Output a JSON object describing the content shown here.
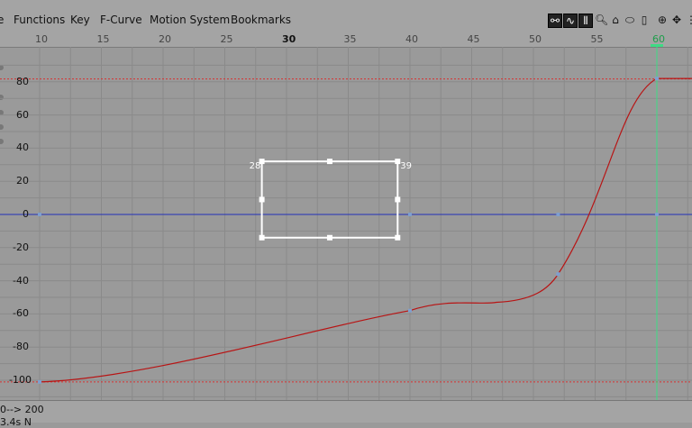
{
  "menubar": {
    "items": [
      {
        "label": "e",
        "name": "menu-edit"
      },
      {
        "label": "Functions",
        "name": "menu-functions"
      },
      {
        "label": "Key",
        "name": "menu-key"
      },
      {
        "label": "F-Curve",
        "name": "menu-f-curve"
      },
      {
        "label": "Motion System",
        "name": "menu-motion-system"
      },
      {
        "label": "Bookmarks",
        "name": "menu-bookmarks"
      }
    ]
  },
  "toolbar": {
    "icons": [
      "curve-link-icon",
      "fcurve-mode-icon",
      "dopesheet-mode-icon",
      "zoom-icon",
      "home-icon",
      "frame-all-icon",
      "sync-icon",
      "new-key-icon",
      "move-icon",
      "more-icon"
    ]
  },
  "timeline": {
    "frames": [
      10,
      15,
      20,
      25,
      30,
      35,
      40,
      45,
      50,
      55,
      60
    ],
    "major_frames": [
      30,
      60
    ],
    "current_frame": 60,
    "current_frame_label": "60"
  },
  "graph": {
    "y_ticks": [
      80,
      60,
      40,
      20,
      0,
      -20,
      -40,
      -60,
      -80,
      -100
    ],
    "y_tick_labels": [
      "80",
      "60",
      "40",
      "20",
      "0",
      "-20",
      "-40",
      "-60",
      "-80",
      "-100"
    ],
    "upper_limit": 82,
    "lower_limit": -101,
    "colors": {
      "curve": "#b81414",
      "zero_line": "#2130b8",
      "limit_line": "#d83030",
      "current_frame_line": "#3ddc84",
      "grid": "#8a8a8a",
      "selection": "#ffffff"
    },
    "curve_keys": [
      {
        "frame": 10,
        "value": -101
      },
      {
        "frame": 40,
        "value": -58
      },
      {
        "frame": 52,
        "value": -36
      },
      {
        "frame": 60,
        "value": 82
      }
    ],
    "selection_box": {
      "start_label": "28",
      "end_label": "39",
      "frame_start": 28,
      "frame_end": 39,
      "value_top": 32,
      "value_bottom": -14
    }
  },
  "status": {
    "range_text": "0--> 200",
    "second_line": "3.4s  N"
  }
}
